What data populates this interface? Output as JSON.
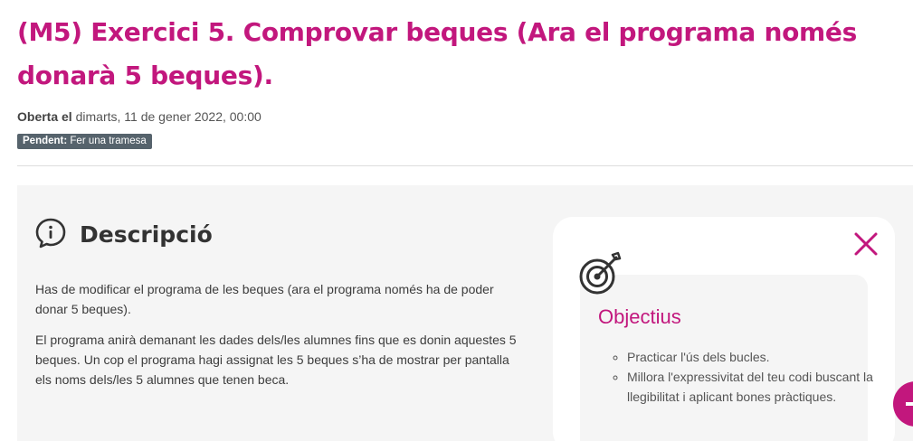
{
  "assignment": {
    "title": "(M5) Exercici 5. Comprovar beques (Ara el programa només donarà 5 beques).",
    "opened_label": "Oberta el",
    "opened_value": "dimarts, 11 de gener 2022, 00:00",
    "status_label": "Pendent:",
    "status_value": "Fer una tramesa"
  },
  "description": {
    "heading": "Descripció",
    "icon": "info-speech-icon",
    "paragraphs": [
      "Has de modificar el programa de les beques (ara el programa només ha de poder donar 5 beques).",
      "El programa anirà demanant les dades dels/les alumnes fins que es donin aquestes 5 beques. Un cop el programa hagi assignat les 5 beques s’ha de mostrar per pantalla els noms dels/les 5 alumnes que tenen beca."
    ]
  },
  "objectives": {
    "heading": "Objectius",
    "icon": "target-icon",
    "close_icon": "close-icon",
    "items": [
      "Practicar l'ús dels bucles.",
      "Millora l'expressivitat del teu codi buscant la llegibilitat i aplicant bones pràctiques."
    ]
  },
  "colors": {
    "accent": "#c2177d",
    "badge_bg": "#56636c",
    "panel_bg": "#f5f5f5"
  }
}
